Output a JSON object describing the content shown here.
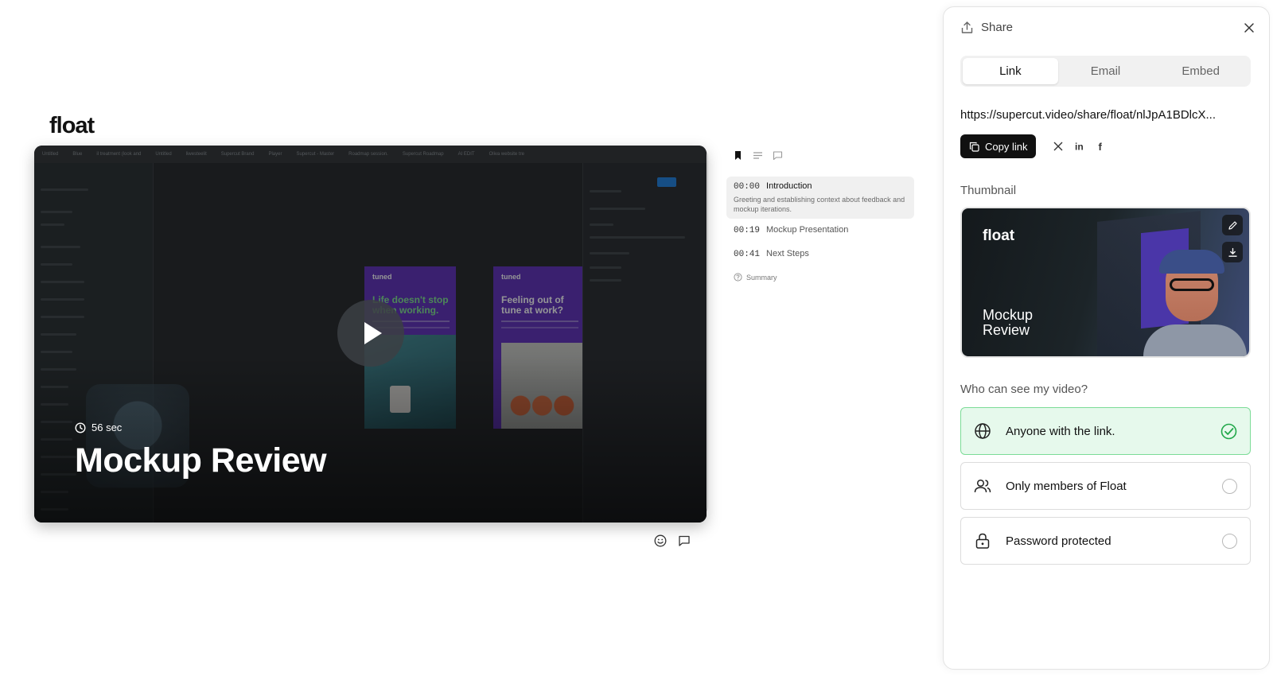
{
  "logo": "float",
  "video": {
    "duration": "56 sec",
    "title": "Mockup Review",
    "tabs": [
      "Untitled",
      "Blue",
      "il treatment (look and",
      "Untitled",
      "liwesteelit",
      "Supercut Brand",
      "Player",
      "Supercut - Master",
      "Roadmap session.",
      "Supercut Roadmap",
      "AI EDIT",
      "Oliva website tre"
    ],
    "frame1": {
      "brand": "tuned",
      "headline": "Life doesn't stop when working."
    },
    "frame2": {
      "brand": "tuned",
      "headline": "Feeling out of tune at work?"
    }
  },
  "chapters": [
    {
      "time": "00:00",
      "name": "Introduction",
      "desc": "Greeting and establishing context about feedback and mockup iterations.",
      "active": true
    },
    {
      "time": "00:19",
      "name": "Mockup Presentation",
      "active": false
    },
    {
      "time": "00:41",
      "name": "Next Steps",
      "active": false
    }
  ],
  "summary_label": "Summary",
  "share": {
    "title": "Share",
    "tabs": [
      "Link",
      "Email",
      "Embed"
    ],
    "active_tab": "Link",
    "url": "https://supercut.video/share/float/nlJpA1BDlcX...",
    "copy_label": "Copy link",
    "socials": [
      "x-icon",
      "linkedin-icon",
      "facebook-icon"
    ],
    "thumbnail_label": "Thumbnail",
    "thumbnail": {
      "logo": "float",
      "title": "Mockup Review"
    },
    "visibility_label": "Who can see my video?",
    "options": [
      {
        "label": "Anyone with the link.",
        "icon": "globe-icon",
        "selected": true
      },
      {
        "label": "Only members of Float",
        "icon": "users-icon",
        "selected": false
      },
      {
        "label": "Password protected",
        "icon": "lock-icon",
        "selected": false
      }
    ]
  },
  "colors": {
    "accent_green": "#22a84a",
    "selected_bg": "#e6f9ec",
    "frame_purple": "#5b2bb8"
  }
}
